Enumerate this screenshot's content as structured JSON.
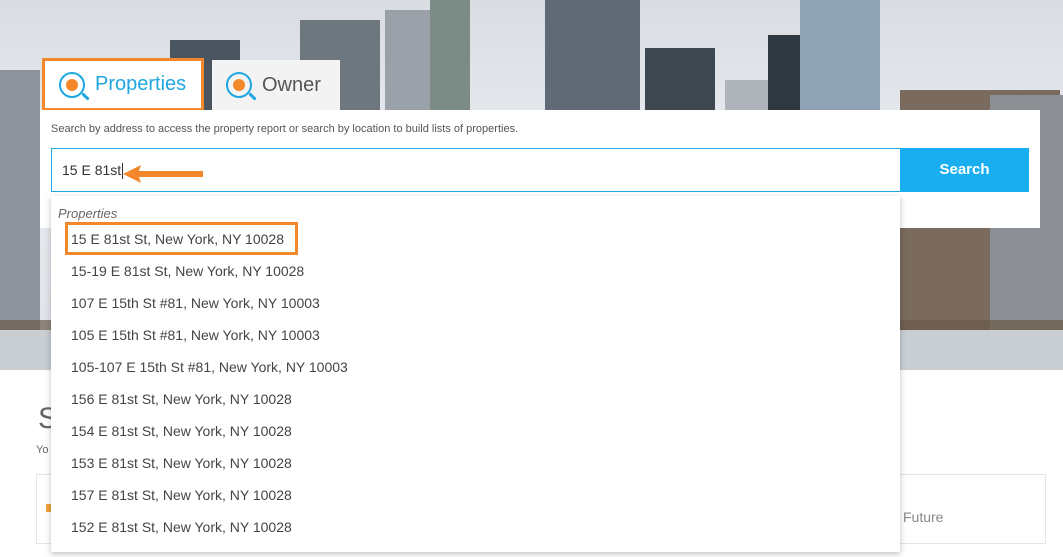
{
  "tabs": [
    {
      "label": "Properties",
      "active": true,
      "icon": "home-search-icon"
    },
    {
      "label": "Owner",
      "active": false,
      "icon": "person-search-icon"
    }
  ],
  "search": {
    "hint": "Search by address to access the property report or search by location to build lists of properties.",
    "value": "15 E 81st",
    "button_label": "Search"
  },
  "dropdown": {
    "group_label": "Properties",
    "items": [
      "15 E 81st St, New York, NY 10028",
      "15-19 E 81st St, New York, NY 10028",
      "107 E 15th St #81, New York, NY 10003",
      "105 E 15th St #81, New York, NY 10003",
      "105-107 E 15th St #81, New York, NY 10003",
      "156 E 81st St, New York, NY 10028",
      "154 E 81st St, New York, NY 10028",
      "153 E 81st St, New York, NY 10028",
      "157 E 81st St, New York, NY 10028",
      "152 E 81st St, New York, NY 10028"
    ]
  },
  "background": {
    "heading": "S",
    "subtext": "Yo",
    "future_label": "Future"
  },
  "colors": {
    "accent_blue": "#18aef0",
    "annotation_orange": "#f2882b"
  }
}
